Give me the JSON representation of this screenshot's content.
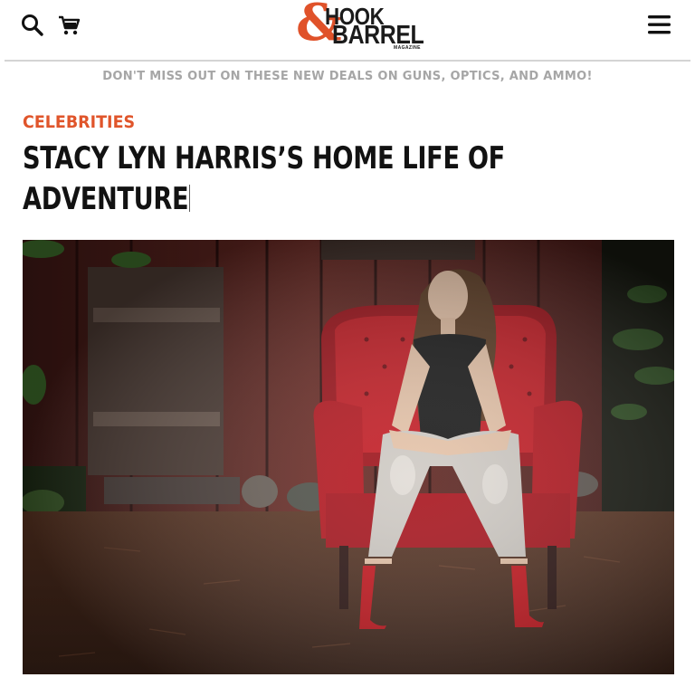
{
  "header": {
    "logo": {
      "line1": "HOOK",
      "line2": "BARREL",
      "sub": "MAGAZINE",
      "ampersand": "&"
    },
    "icons": {
      "search": "search-icon",
      "cart": "cart-icon",
      "menu": "hamburger-menu-icon"
    }
  },
  "promo": {
    "text": "DON'T MISS OUT ON THESE NEW DEALS ON GUNS, OPTICS, AND AMMO!"
  },
  "article": {
    "category": "CELEBRITIES",
    "title": "STACY LYN HARRIS’S HOME LIFE OF ADVENTURE"
  },
  "colors": {
    "brand_orange": "#e0552b",
    "text_dark": "#121212",
    "promo_gray": "#a6a6a6",
    "chair_red": "#b3121a"
  }
}
